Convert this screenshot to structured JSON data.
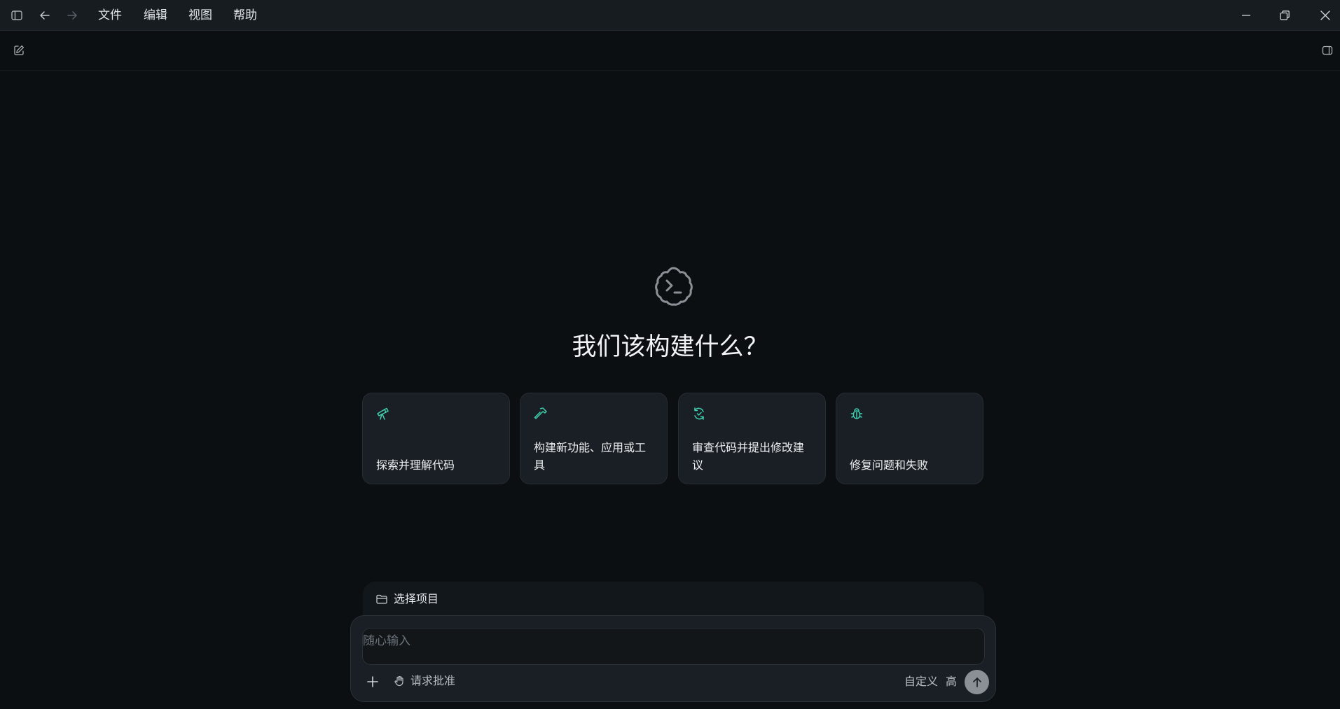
{
  "window": {
    "menu": [
      "文件",
      "编辑",
      "视图",
      "帮助"
    ],
    "icons": {
      "sidebar_toggle": "sidebar-toggle-icon",
      "back": "arrow-left-icon",
      "forward": "arrow-right-icon",
      "minimize": "minimize-icon",
      "restore": "restore-icon",
      "close": "close-icon"
    }
  },
  "toolbar": {
    "new_chat_icon": "edit-icon",
    "panel_icon": "panel-icon"
  },
  "hero": {
    "logo_icon": "terminal-cloud-icon",
    "title": "我们该构建什么？"
  },
  "cards": [
    {
      "icon": "telescope-icon",
      "label": "探索并理解代码"
    },
    {
      "icon": "hammer-icon",
      "label": "构建新功能、应用或工具"
    },
    {
      "icon": "refresh-check-icon",
      "label": "审查代码并提出修改建议"
    },
    {
      "icon": "bug-icon",
      "label": "修复问题和失败"
    }
  ],
  "project": {
    "icon": "folder-icon",
    "label": "选择项目"
  },
  "composer": {
    "placeholder": "随心输入",
    "add_icon": "plus-icon",
    "approval_icon": "hand-icon",
    "approval_label": "请求批准",
    "custom_label": "自定义",
    "level_label": "高",
    "send_icon": "arrow-up-icon"
  },
  "colors": {
    "accent": "#3fd0b0",
    "background": "#0b0f12",
    "titlebar": "#171c21",
    "card": "#1a1f25"
  }
}
